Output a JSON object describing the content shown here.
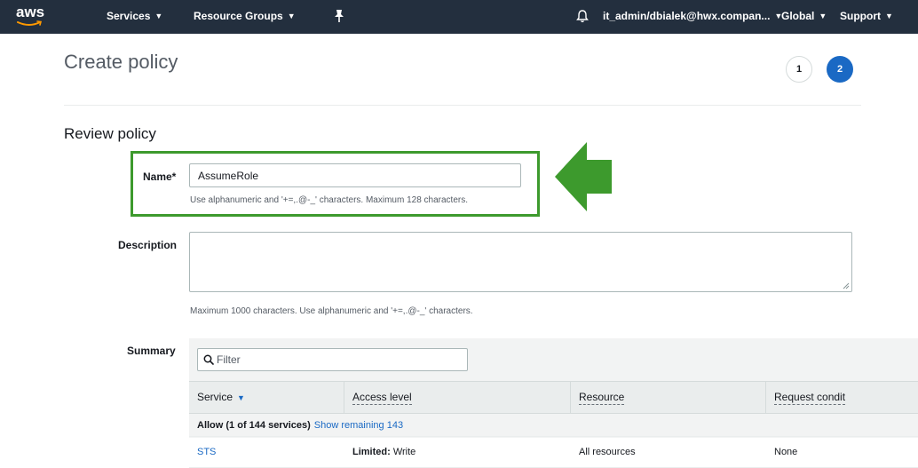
{
  "topbar": {
    "logo": "aws",
    "services_label": "Services",
    "resource_groups_label": "Resource Groups",
    "account_label": "it_admin/dbialek@hwx.compan...",
    "region_label": "Global",
    "support_label": "Support",
    "icons": [
      "pin-icon",
      "bell-icon"
    ]
  },
  "page": {
    "title": "Create policy",
    "steps": [
      "1",
      "2"
    ],
    "active_step": "2"
  },
  "section": {
    "title": "Review policy"
  },
  "name_field": {
    "label": "Name*",
    "value": "AssumeRole",
    "hint": "Use alphanumeric and '+=,.@-_' characters. Maximum 128 characters."
  },
  "description_field": {
    "label": "Description",
    "value": "",
    "hint": "Maximum 1000 characters. Use alphanumeric and '+=,.@-_' characters."
  },
  "summary": {
    "label": "Summary",
    "filter_placeholder": "Filter",
    "columns": [
      "Service",
      "Access level",
      "Resource",
      "Request condit"
    ],
    "allow_text": "Allow (1 of 144 services)",
    "show_remaining": "Show remaining 143",
    "rows": [
      {
        "service": "STS",
        "access_level_bold": "Limited:",
        "access_level_rest": " Write",
        "resource": "All resources",
        "request_condition": "None"
      }
    ]
  },
  "colors": {
    "topbar": "#232f3e",
    "highlight": "#3d9a2d",
    "link": "#1a69c4",
    "active_step": "#1a69c4"
  }
}
